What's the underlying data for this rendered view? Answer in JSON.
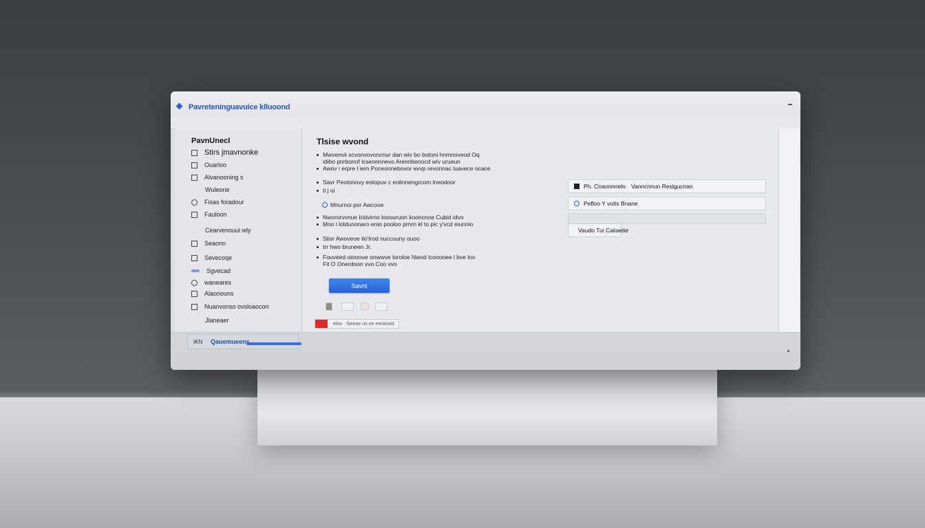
{
  "window": {
    "title": "Pavreteninguavuice klluoond"
  },
  "sidebar": {
    "heading": "PavnUnecl",
    "items": [
      {
        "label": "Stirs jmavnonke",
        "icon": "checkbox-icon"
      },
      {
        "label": "Ouarloo",
        "icon": "grid-icon"
      },
      {
        "label": "Alvanooning s",
        "icon": "checkbox-icon"
      },
      {
        "label": "Wuleone",
        "icon": "none"
      },
      {
        "label": "Fisas foradour",
        "icon": "image-icon"
      },
      {
        "label": "Fauloon",
        "icon": "grid-icon"
      },
      {
        "label": "Cearvenouul wly",
        "icon": "none"
      },
      {
        "label": "Seaonn",
        "icon": "checkbox-icon"
      },
      {
        "label": "Sevecoqe",
        "icon": "checkbox-icon"
      },
      {
        "label": "Sgvecad",
        "icon": "toggle-icon"
      },
      {
        "label": "waneares",
        "icon": "link-icon"
      },
      {
        "label": "Alaonouns",
        "icon": "checkbox-icon"
      },
      {
        "label": "Nuanvonso ovsloaocon",
        "icon": "grid-icon"
      },
      {
        "label": "Jlaneaer",
        "icon": "none"
      }
    ],
    "footer": {
      "key": "IKN",
      "label": "Qauemueens"
    }
  },
  "main": {
    "title": "Tlsise wvond",
    "lines": [
      {
        "text": "Mwvenvii scvonvovoncnur dan wiv bo botoni hnmnoveod Oq",
        "dot": true
      },
      {
        "text": "idibo pnrbonof lcseonnnevo Arennbonocd wiv urueun",
        "dot": false
      },
      {
        "text": "Awov i erpre l iem Poceonnebovor evvp revonnac luavece ocace",
        "dot": true
      },
      {
        "text": "Savr Peotonovy eotopuv c eolinnengrcom lneodoor",
        "dot": true
      },
      {
        "text": "ti j oi",
        "dot": true
      },
      {
        "text": "Nwororvvnue Iridvirno looouruon kooncnoe Cubid idvo",
        "dot": true
      },
      {
        "text": "Moo l loldunonaro enio pooloo prnrn kl to pic y'vcd eiunnio",
        "dot": true
      },
      {
        "text": "Stisr Awoveoe ilo'Irod nuccouny ouoo",
        "dot": true
      },
      {
        "text": "trr hwo bruneen Jr.",
        "dot": true
      },
      {
        "text": "Fouveed oioonoe onwwve loroloe Nwod lcooonee l bve loo",
        "dot": true
      },
      {
        "text": "Fit O Onerdoon vvo Coo vvo",
        "dot": false
      }
    ],
    "radio_label": "Mnurnoi por Awcooe",
    "primary_button": "Savnt",
    "badge_text": "eleo · Neeae oo ee eeneood"
  },
  "right_panel": {
    "rows": [
      {
        "label": "Ph. Cnaonnnelo",
        "value": "Vanncnnun Reslgucnan",
        "icon": "file-icon"
      },
      {
        "label": "Pefloo Y voits Bnane",
        "value": "",
        "icon": "edit-icon"
      },
      {
        "label": "",
        "value": "",
        "icon": "none"
      },
      {
        "label": "Vaudo Tui Caliaetie",
        "value": "",
        "icon": "refresh-icon"
      }
    ]
  },
  "colors": {
    "accent": "#2f5fc4",
    "button": "#2563d6",
    "badge_red": "#e02a2a"
  }
}
